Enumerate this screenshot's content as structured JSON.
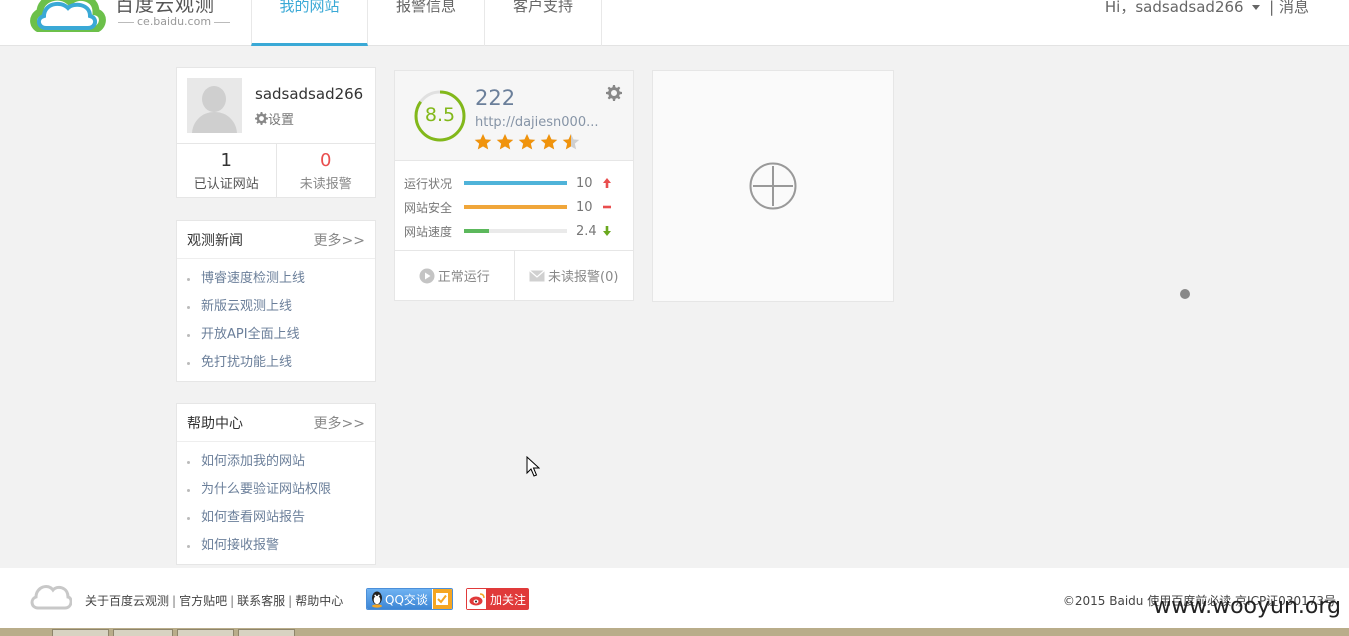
{
  "header": {
    "logo_title": "百度云观测",
    "logo_sub": "ce.baidu.com",
    "nav": [
      {
        "label": "我的网站",
        "active": true
      },
      {
        "label": "报警信息",
        "active": false
      },
      {
        "label": "客户支持",
        "active": false
      }
    ],
    "greeting": "Hi，sadsadsad266",
    "divider": "|",
    "messages": "消息"
  },
  "profile": {
    "username": "sadsadsad266",
    "settings_label": "设置",
    "verified_count": "1",
    "verified_label": "已认证网站",
    "unread_count": "0",
    "unread_label": "未读报警"
  },
  "news": {
    "title": "观测新闻",
    "more": "更多>>",
    "items": [
      "博睿速度检测上线",
      "新版云观测上线",
      "开放API全面上线",
      "免打扰功能上线"
    ]
  },
  "help": {
    "title": "帮助中心",
    "more": "更多>>",
    "items": [
      "如何添加我的网站",
      "为什么要验证网站权限",
      "如何查看网站报告",
      "如何接收报警"
    ]
  },
  "site_card": {
    "score": "8.5",
    "score_fraction": 0.85,
    "name": "222",
    "url": "http://dajiesn000...",
    "rating": 4.5,
    "metrics": [
      {
        "label": "运行状况",
        "value": "10",
        "level": 1.0,
        "color": "#4fb3d9",
        "trend": "up",
        "trend_color": "#e94e4e"
      },
      {
        "label": "网站安全",
        "value": "10",
        "level": 1.0,
        "color": "#f0a63a",
        "trend": "flat",
        "trend_color": "#e94e4e"
      },
      {
        "label": "网站速度",
        "value": "2.4",
        "level": 0.24,
        "color": "#5cb85c",
        "trend": "down",
        "trend_color": "#6aa81e"
      }
    ],
    "status_label": "正常运行",
    "alerts_label": "未读报警(0)"
  },
  "footer": {
    "links": [
      "关于百度云观测",
      "官方贴吧",
      "联系客服",
      "帮助中心"
    ],
    "qq_label": "QQ交谈",
    "weibo_label": "加关注",
    "copyright": "©2015 Baidu 使用百度前必读 京ICP证030173号",
    "watermark": "www.wooyun.org"
  },
  "colors": {
    "accent": "#3aa9d6",
    "score_green": "#82b81a",
    "star_orange": "#f0930c",
    "alert_red": "#e94e4e"
  }
}
